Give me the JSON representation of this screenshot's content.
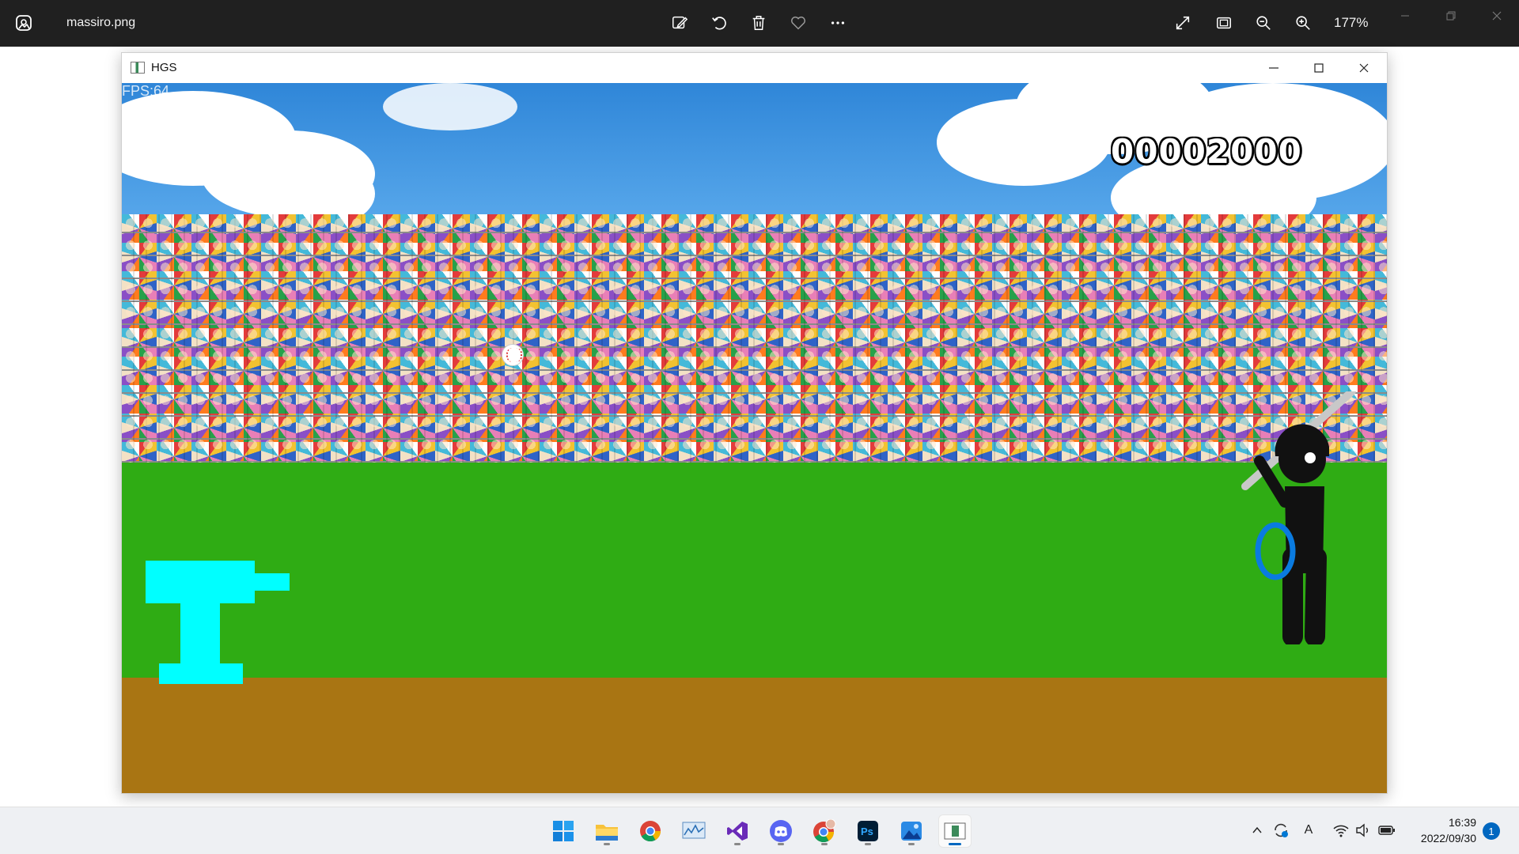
{
  "viewer": {
    "file_name": "massiro.png",
    "zoom": "177%",
    "icons": [
      "photos-app-icon",
      "edit-image-icon",
      "rotate-icon",
      "delete-icon",
      "favorite-icon",
      "more-icon",
      "fullscreen-icon",
      "fit-window-icon",
      "zoom-out-icon",
      "zoom-in-icon",
      "minimize-icon",
      "restore-icon",
      "close-icon"
    ]
  },
  "window": {
    "title": "HGS",
    "controls": [
      "minimize",
      "maximize",
      "close"
    ]
  },
  "game": {
    "fps": "FPS:64",
    "score": "00002000",
    "colors": {
      "sky": "#4a9ee6",
      "grass": "#2fac14",
      "dirt": "#a97513",
      "pitching_machine": "#00ffff",
      "batter": "#111111",
      "swing_ring": "#0a7be0"
    }
  },
  "taskbar": {
    "apps": [
      "start-button",
      "file-explorer",
      "chrome",
      "resource-monitor",
      "visual-studio",
      "discord",
      "chrome-profile",
      "photoshop",
      "photos",
      "hgs-app"
    ],
    "tray": {
      "time": "16:39",
      "date": "2022/09/30",
      "notifications": "1",
      "ime": "A"
    }
  }
}
